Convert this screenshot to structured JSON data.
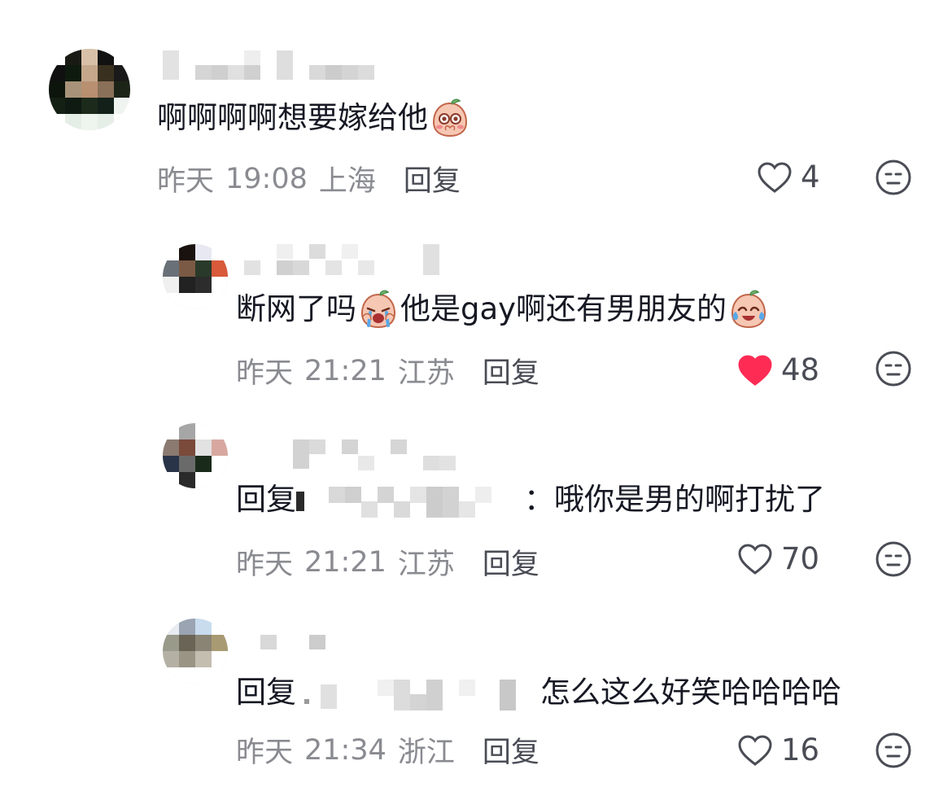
{
  "comments": [
    {
      "text_before": "啊啊啊啊想要嫁给他",
      "emoji": "blushing-face-emoji",
      "date": "昨天",
      "time": "19:08",
      "location": "上海",
      "reply_label": "回复",
      "likes": "4",
      "liked": false
    },
    {
      "text_before": "断网了吗",
      "emoji_1": "crying-face-emoji",
      "text_middle": "他是gay啊还有男朋友的",
      "emoji_2": "laughing-crying-face-emoji",
      "date": "昨天",
      "time": "21:21",
      "location": "江苏",
      "reply_label": "回复",
      "likes": "48",
      "liked": true
    },
    {
      "prefix": "回复",
      "text_after": "：哦你是男的啊打扰了",
      "date": "昨天",
      "time": "21:21",
      "location": "江苏",
      "reply_label": "回复",
      "likes": "70",
      "liked": false
    },
    {
      "prefix": "回复",
      "text_after": "怎么这么好笑哈哈哈哈",
      "date": "昨天",
      "time": "21:34",
      "location": "浙江",
      "reply_label": "回复",
      "likes": "16",
      "liked": false
    }
  ],
  "colors": {
    "like_active": "#fe2c55",
    "muted": "#8a8b91",
    "text": "#161823"
  }
}
